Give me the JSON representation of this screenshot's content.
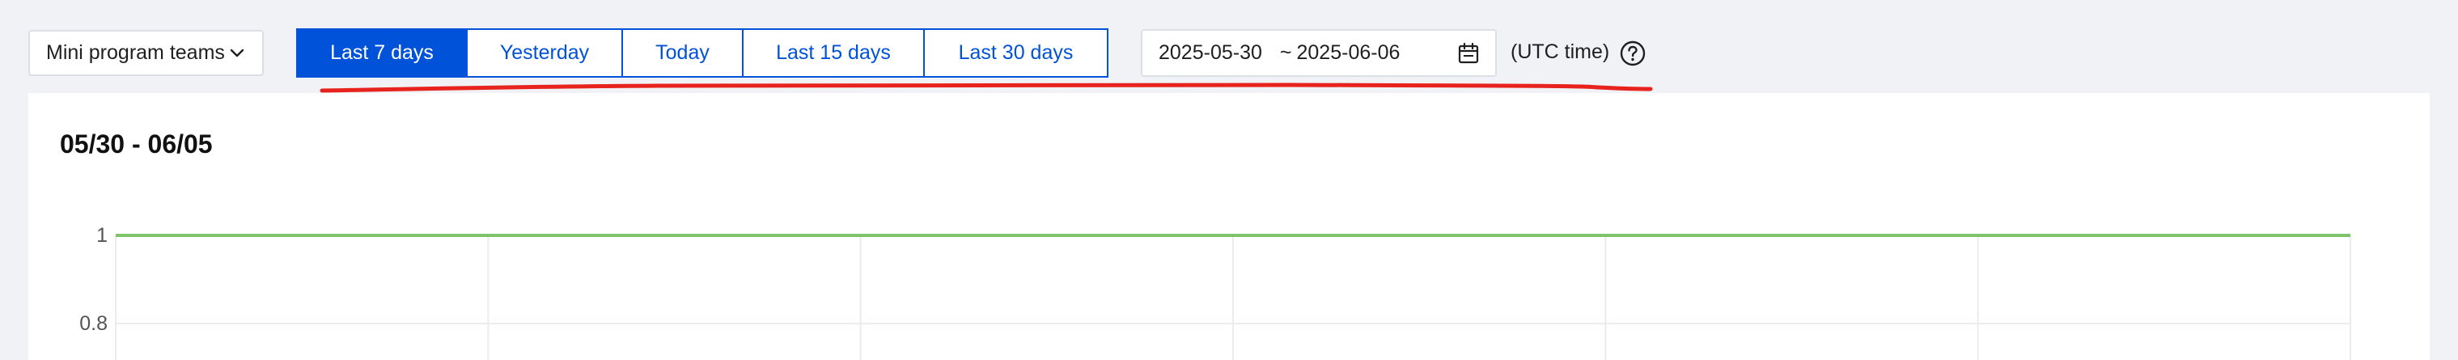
{
  "toolbar": {
    "team_select": {
      "value": "Mini program teams"
    },
    "ranges": [
      {
        "label": "Last 7 days",
        "active": true
      },
      {
        "label": "Yesterday",
        "active": false
      },
      {
        "label": "Today",
        "active": false
      },
      {
        "label": "Last 15 days",
        "active": false
      },
      {
        "label": "Last 30 days",
        "active": false
      }
    ],
    "date_range": {
      "start": "2025-05-30",
      "separator": "~",
      "end": "2025-06-06"
    },
    "timezone_label": "(UTC time)",
    "icons": {
      "team_select": "chevron-down-icon",
      "date_range": "calendar-icon",
      "help": "question-circle-icon"
    }
  },
  "card": {
    "title": "05/30 - 06/05"
  },
  "chart_data": {
    "type": "line",
    "title": "05/30 - 06/05",
    "y_ticks": [
      "1",
      "0.8"
    ],
    "series": [
      {
        "values": [
          1,
          1,
          1,
          1,
          1,
          1,
          1
        ]
      }
    ],
    "grid": true,
    "colors": {
      "series": "#7ec46a"
    }
  },
  "colors": {
    "accent": "#0052d9",
    "annotation": "#e8221c",
    "background": "#f0f2f6"
  }
}
